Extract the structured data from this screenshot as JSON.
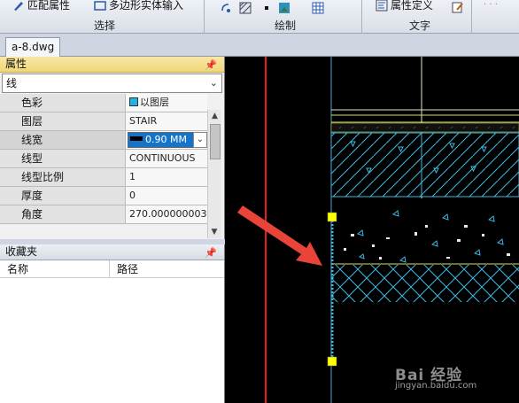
{
  "ribbon": {
    "match_props_label": "匹配属性",
    "polygon_solid_label": "多边形实体输入",
    "group_select": "选择",
    "group_draw": "绘制",
    "text_style_label": "属性定义",
    "group_text": "文字"
  },
  "tabs": [
    {
      "label": "a-8.dwg"
    }
  ],
  "properties": {
    "title": "属性",
    "object_type": "线",
    "rows": [
      {
        "label": "色彩",
        "value": "以图层"
      },
      {
        "label": "图层",
        "value": "STAIR"
      },
      {
        "label": "线宽",
        "value": "0.90 MM"
      },
      {
        "label": "线型",
        "value": "CONTINUOUS"
      },
      {
        "label": "线型比例",
        "value": "1"
      },
      {
        "label": "厚度",
        "value": "0"
      },
      {
        "label": "角度",
        "value": "270.000000003"
      }
    ],
    "color_swatch": "#1fb4e8"
  },
  "favorites": {
    "title": "收藏夹",
    "col_name": "名称",
    "col_path": "路径"
  },
  "watermark": {
    "text": "Bai 经验",
    "url": "jingyan.baidu.com"
  },
  "colors": {
    "canvas_bg": "#000000",
    "accent_red": "#e02020",
    "arrow_red": "#e8443a",
    "hatch_cyan": "#3fb8e0",
    "grip_yellow": "#ffff00"
  }
}
